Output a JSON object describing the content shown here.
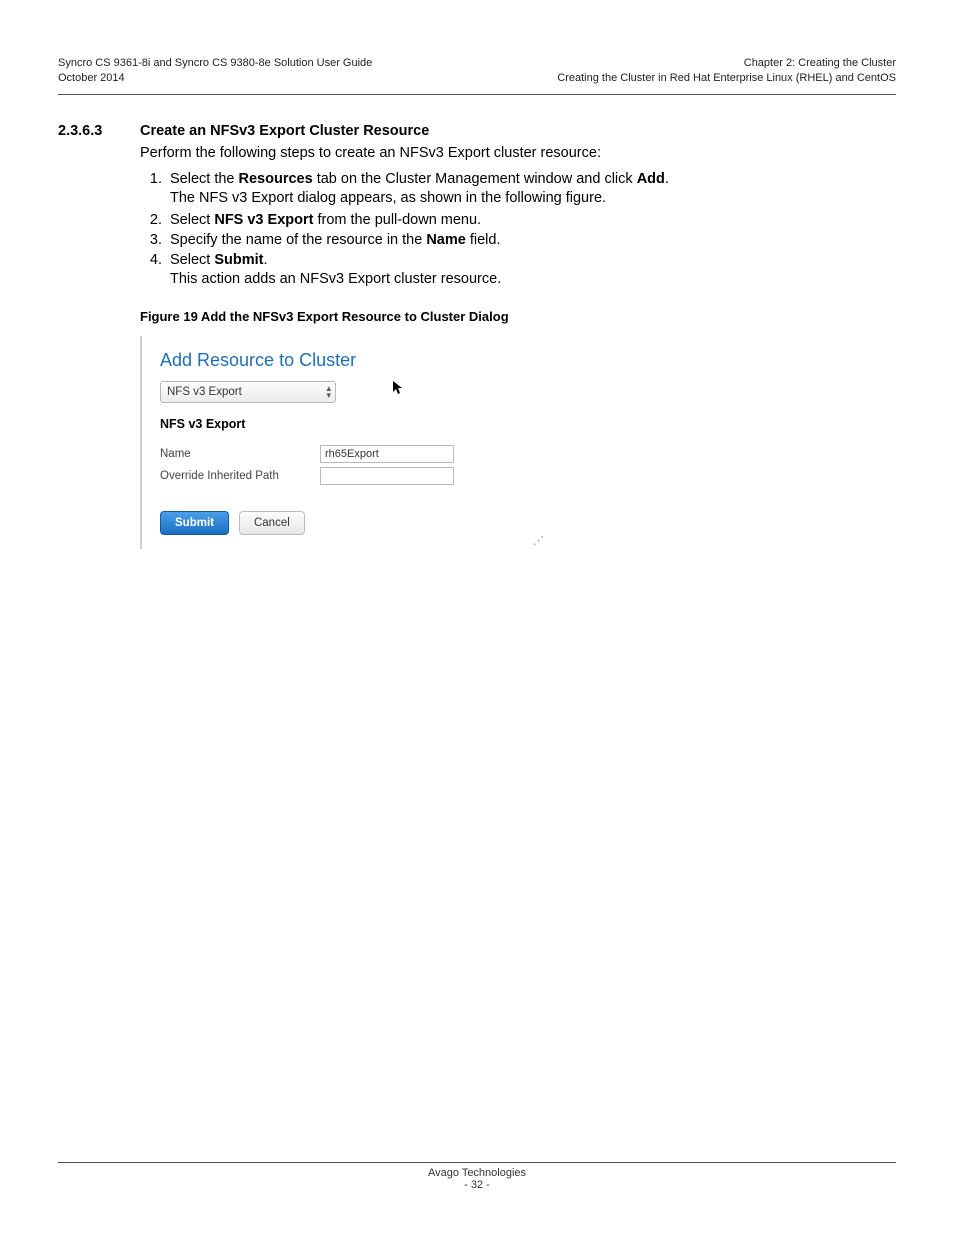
{
  "header": {
    "left_line1": "Syncro CS 9361-8i and Syncro CS 9380-8e Solution User Guide",
    "left_line2": "October 2014",
    "right_line1": "Chapter 2: Creating the Cluster",
    "right_line2": "Creating the Cluster in Red Hat Enterprise Linux (RHEL) and CentOS"
  },
  "section": {
    "number": "2.3.6.3",
    "title": "Create an NFSv3 Export Cluster Resource",
    "intro": "Perform the following steps to create an NFSv3 Export cluster resource:",
    "steps": [
      {
        "pre": "Select the ",
        "bold1": "Resources",
        "mid": " tab on the Cluster Management window and click ",
        "bold2": "Add",
        "post": ".",
        "sub": "The NFS v3 Export dialog appears, as shown in the following figure."
      },
      {
        "pre": "Select ",
        "bold1": "NFS v3 Export",
        "post": " from the pull-down menu."
      },
      {
        "pre": "Specify the name of the resource in the ",
        "bold1": "Name",
        "post": " field."
      },
      {
        "pre": "Select ",
        "bold1": "Submit",
        "post": ".",
        "sub": "This action adds an NFSv3 Export cluster resource."
      }
    ],
    "figure_caption": "Figure 19  Add the NFSv3 Export Resource to Cluster Dialog"
  },
  "dialog": {
    "title": "Add Resource to Cluster",
    "dropdown_value": "NFS v3 Export",
    "group_label": "NFS v3 Export",
    "field_name_label": "Name",
    "field_name_value": "rh65Export",
    "field_path_label": "Override Inherited Path",
    "field_path_value": "",
    "submit_label": "Submit",
    "cancel_label": "Cancel"
  },
  "footer": {
    "company": "Avago Technologies",
    "page": "- 32 -"
  }
}
